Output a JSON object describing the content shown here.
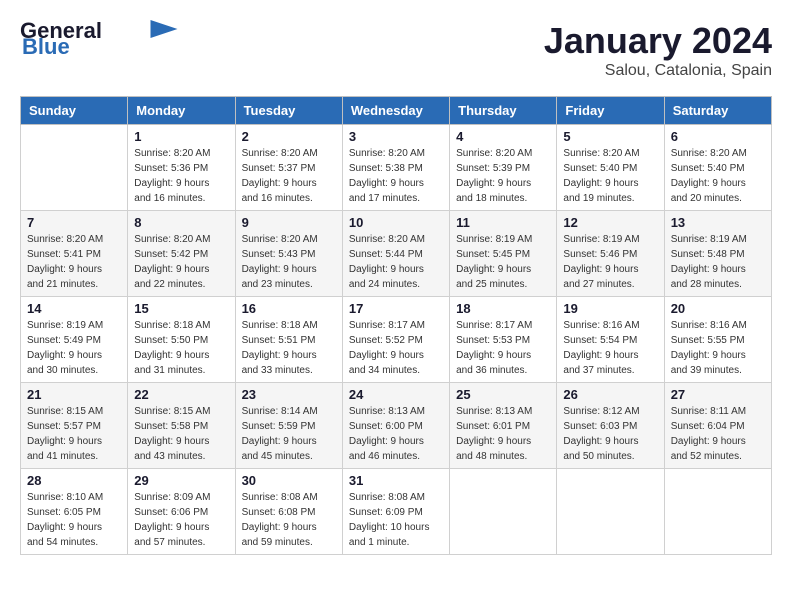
{
  "header": {
    "logo_general": "General",
    "logo_blue": "Blue",
    "month_year": "January 2024",
    "location": "Salou, Catalonia, Spain"
  },
  "days_of_week": [
    "Sunday",
    "Monday",
    "Tuesday",
    "Wednesday",
    "Thursday",
    "Friday",
    "Saturday"
  ],
  "weeks": [
    [
      {
        "day": "",
        "sunrise": "",
        "sunset": "",
        "daylight": ""
      },
      {
        "day": "1",
        "sunrise": "Sunrise: 8:20 AM",
        "sunset": "Sunset: 5:36 PM",
        "daylight": "Daylight: 9 hours and 16 minutes."
      },
      {
        "day": "2",
        "sunrise": "Sunrise: 8:20 AM",
        "sunset": "Sunset: 5:37 PM",
        "daylight": "Daylight: 9 hours and 16 minutes."
      },
      {
        "day": "3",
        "sunrise": "Sunrise: 8:20 AM",
        "sunset": "Sunset: 5:38 PM",
        "daylight": "Daylight: 9 hours and 17 minutes."
      },
      {
        "day": "4",
        "sunrise": "Sunrise: 8:20 AM",
        "sunset": "Sunset: 5:39 PM",
        "daylight": "Daylight: 9 hours and 18 minutes."
      },
      {
        "day": "5",
        "sunrise": "Sunrise: 8:20 AM",
        "sunset": "Sunset: 5:40 PM",
        "daylight": "Daylight: 9 hours and 19 minutes."
      },
      {
        "day": "6",
        "sunrise": "Sunrise: 8:20 AM",
        "sunset": "Sunset: 5:40 PM",
        "daylight": "Daylight: 9 hours and 20 minutes."
      }
    ],
    [
      {
        "day": "7",
        "sunrise": "Sunrise: 8:20 AM",
        "sunset": "Sunset: 5:41 PM",
        "daylight": "Daylight: 9 hours and 21 minutes."
      },
      {
        "day": "8",
        "sunrise": "Sunrise: 8:20 AM",
        "sunset": "Sunset: 5:42 PM",
        "daylight": "Daylight: 9 hours and 22 minutes."
      },
      {
        "day": "9",
        "sunrise": "Sunrise: 8:20 AM",
        "sunset": "Sunset: 5:43 PM",
        "daylight": "Daylight: 9 hours and 23 minutes."
      },
      {
        "day": "10",
        "sunrise": "Sunrise: 8:20 AM",
        "sunset": "Sunset: 5:44 PM",
        "daylight": "Daylight: 9 hours and 24 minutes."
      },
      {
        "day": "11",
        "sunrise": "Sunrise: 8:19 AM",
        "sunset": "Sunset: 5:45 PM",
        "daylight": "Daylight: 9 hours and 25 minutes."
      },
      {
        "day": "12",
        "sunrise": "Sunrise: 8:19 AM",
        "sunset": "Sunset: 5:46 PM",
        "daylight": "Daylight: 9 hours and 27 minutes."
      },
      {
        "day": "13",
        "sunrise": "Sunrise: 8:19 AM",
        "sunset": "Sunset: 5:48 PM",
        "daylight": "Daylight: 9 hours and 28 minutes."
      }
    ],
    [
      {
        "day": "14",
        "sunrise": "Sunrise: 8:19 AM",
        "sunset": "Sunset: 5:49 PM",
        "daylight": "Daylight: 9 hours and 30 minutes."
      },
      {
        "day": "15",
        "sunrise": "Sunrise: 8:18 AM",
        "sunset": "Sunset: 5:50 PM",
        "daylight": "Daylight: 9 hours and 31 minutes."
      },
      {
        "day": "16",
        "sunrise": "Sunrise: 8:18 AM",
        "sunset": "Sunset: 5:51 PM",
        "daylight": "Daylight: 9 hours and 33 minutes."
      },
      {
        "day": "17",
        "sunrise": "Sunrise: 8:17 AM",
        "sunset": "Sunset: 5:52 PM",
        "daylight": "Daylight: 9 hours and 34 minutes."
      },
      {
        "day": "18",
        "sunrise": "Sunrise: 8:17 AM",
        "sunset": "Sunset: 5:53 PM",
        "daylight": "Daylight: 9 hours and 36 minutes."
      },
      {
        "day": "19",
        "sunrise": "Sunrise: 8:16 AM",
        "sunset": "Sunset: 5:54 PM",
        "daylight": "Daylight: 9 hours and 37 minutes."
      },
      {
        "day": "20",
        "sunrise": "Sunrise: 8:16 AM",
        "sunset": "Sunset: 5:55 PM",
        "daylight": "Daylight: 9 hours and 39 minutes."
      }
    ],
    [
      {
        "day": "21",
        "sunrise": "Sunrise: 8:15 AM",
        "sunset": "Sunset: 5:57 PM",
        "daylight": "Daylight: 9 hours and 41 minutes."
      },
      {
        "day": "22",
        "sunrise": "Sunrise: 8:15 AM",
        "sunset": "Sunset: 5:58 PM",
        "daylight": "Daylight: 9 hours and 43 minutes."
      },
      {
        "day": "23",
        "sunrise": "Sunrise: 8:14 AM",
        "sunset": "Sunset: 5:59 PM",
        "daylight": "Daylight: 9 hours and 45 minutes."
      },
      {
        "day": "24",
        "sunrise": "Sunrise: 8:13 AM",
        "sunset": "Sunset: 6:00 PM",
        "daylight": "Daylight: 9 hours and 46 minutes."
      },
      {
        "day": "25",
        "sunrise": "Sunrise: 8:13 AM",
        "sunset": "Sunset: 6:01 PM",
        "daylight": "Daylight: 9 hours and 48 minutes."
      },
      {
        "day": "26",
        "sunrise": "Sunrise: 8:12 AM",
        "sunset": "Sunset: 6:03 PM",
        "daylight": "Daylight: 9 hours and 50 minutes."
      },
      {
        "day": "27",
        "sunrise": "Sunrise: 8:11 AM",
        "sunset": "Sunset: 6:04 PM",
        "daylight": "Daylight: 9 hours and 52 minutes."
      }
    ],
    [
      {
        "day": "28",
        "sunrise": "Sunrise: 8:10 AM",
        "sunset": "Sunset: 6:05 PM",
        "daylight": "Daylight: 9 hours and 54 minutes."
      },
      {
        "day": "29",
        "sunrise": "Sunrise: 8:09 AM",
        "sunset": "Sunset: 6:06 PM",
        "daylight": "Daylight: 9 hours and 57 minutes."
      },
      {
        "day": "30",
        "sunrise": "Sunrise: 8:08 AM",
        "sunset": "Sunset: 6:08 PM",
        "daylight": "Daylight: 9 hours and 59 minutes."
      },
      {
        "day": "31",
        "sunrise": "Sunrise: 8:08 AM",
        "sunset": "Sunset: 6:09 PM",
        "daylight": "Daylight: 10 hours and 1 minute."
      },
      {
        "day": "",
        "sunrise": "",
        "sunset": "",
        "daylight": ""
      },
      {
        "day": "",
        "sunrise": "",
        "sunset": "",
        "daylight": ""
      },
      {
        "day": "",
        "sunrise": "",
        "sunset": "",
        "daylight": ""
      }
    ]
  ]
}
